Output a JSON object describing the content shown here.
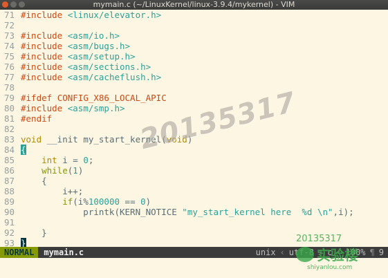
{
  "window": {
    "title": "mymain.c (~/LinuxKernel/linux-3.9.4/mykernel) - VIM"
  },
  "lines": [
    {
      "n": "71",
      "parts": [
        [
          "kw-pre",
          "#include"
        ],
        [
          "code",
          " "
        ],
        [
          "str",
          "<linux/elevator.h>"
        ]
      ]
    },
    {
      "n": "72",
      "parts": []
    },
    {
      "n": "73",
      "parts": [
        [
          "kw-pre",
          "#include"
        ],
        [
          "code",
          " "
        ],
        [
          "str",
          "<asm/io.h>"
        ]
      ]
    },
    {
      "n": "74",
      "parts": [
        [
          "kw-pre",
          "#include"
        ],
        [
          "code",
          " "
        ],
        [
          "str",
          "<asm/bugs.h>"
        ]
      ]
    },
    {
      "n": "75",
      "parts": [
        [
          "kw-pre",
          "#include"
        ],
        [
          "code",
          " "
        ],
        [
          "str",
          "<asm/setup.h>"
        ]
      ]
    },
    {
      "n": "76",
      "parts": [
        [
          "kw-pre",
          "#include"
        ],
        [
          "code",
          " "
        ],
        [
          "str",
          "<asm/sections.h>"
        ]
      ]
    },
    {
      "n": "77",
      "parts": [
        [
          "kw-pre",
          "#include"
        ],
        [
          "code",
          " "
        ],
        [
          "str",
          "<asm/cacheflush.h>"
        ]
      ]
    },
    {
      "n": "78",
      "parts": []
    },
    {
      "n": "79",
      "parts": [
        [
          "kw-pre",
          "#ifdef"
        ],
        [
          "code",
          " "
        ],
        [
          "kw-pre",
          "CONFIG_X86_LOCAL_APIC"
        ]
      ]
    },
    {
      "n": "80",
      "parts": [
        [
          "kw-pre",
          "#include"
        ],
        [
          "code",
          " "
        ],
        [
          "str",
          "<asm/smp.h>"
        ]
      ]
    },
    {
      "n": "81",
      "parts": [
        [
          "kw-pre",
          "#endif"
        ]
      ]
    },
    {
      "n": "82",
      "parts": []
    },
    {
      "n": "83",
      "parts": [
        [
          "ty",
          "void"
        ],
        [
          "code",
          " __init my_start_kernel("
        ],
        [
          "ty",
          "void"
        ],
        [
          "code",
          ")"
        ]
      ]
    },
    {
      "n": "84",
      "parts": [
        [
          "brace-hl",
          "{"
        ]
      ]
    },
    {
      "n": "85",
      "parts": [
        [
          "code",
          "    "
        ],
        [
          "ty",
          "int"
        ],
        [
          "code",
          " i = "
        ],
        [
          "num",
          "0"
        ],
        [
          "code",
          ";"
        ]
      ]
    },
    {
      "n": "86",
      "parts": [
        [
          "code",
          "    "
        ],
        [
          "kw",
          "while"
        ],
        [
          "code",
          "("
        ],
        [
          "num",
          "1"
        ],
        [
          "code",
          ")"
        ]
      ]
    },
    {
      "n": "87",
      "parts": [
        [
          "code",
          "    {"
        ]
      ]
    },
    {
      "n": "88",
      "parts": [
        [
          "code",
          "        i++;"
        ]
      ]
    },
    {
      "n": "89",
      "parts": [
        [
          "code",
          "        "
        ],
        [
          "kw",
          "if"
        ],
        [
          "code",
          "(i%"
        ],
        [
          "num",
          "100000"
        ],
        [
          "code",
          " == "
        ],
        [
          "num",
          "0"
        ],
        [
          "code",
          ")"
        ]
      ]
    },
    {
      "n": "90",
      "parts": [
        [
          "code",
          "            printk(KERN_NOTICE "
        ],
        [
          "str",
          "\"my_start_kernel here  %d \\n\""
        ],
        [
          "code",
          ",i);"
        ]
      ]
    },
    {
      "n": "91",
      "parts": []
    },
    {
      "n": "92",
      "parts": [
        [
          "code",
          "    }"
        ]
      ]
    },
    {
      "n": "93",
      "parts": [
        [
          "cursor-hl",
          "}"
        ]
      ]
    }
  ],
  "watermark": "20135317",
  "statusline": {
    "mode": "NORMAL",
    "filename": "mymain.c",
    "fileformat": "unix",
    "encoding": "utf-8",
    "filetype": "c",
    "percent": "100%",
    "position": "9"
  },
  "logo": {
    "id": "20135317",
    "name": "实验楼",
    "url": "shiyanlou.com"
  }
}
